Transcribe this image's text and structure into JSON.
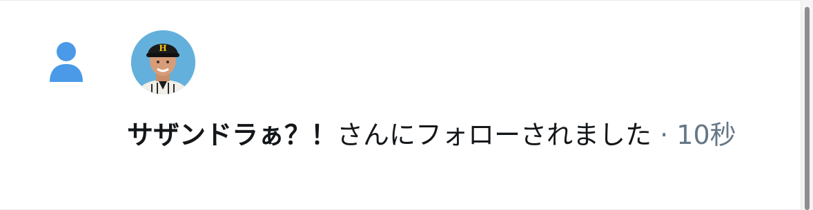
{
  "notification": {
    "type_icon": "person-icon",
    "avatar_label": "user-avatar",
    "user_name": "サザンドラぁ？！",
    "action_text": "さんにフォローされました",
    "separator": " · ",
    "time": "10秒"
  },
  "colors": {
    "icon_blue": "#4a9ae8",
    "text": "#14171a",
    "muted": "#657786"
  }
}
